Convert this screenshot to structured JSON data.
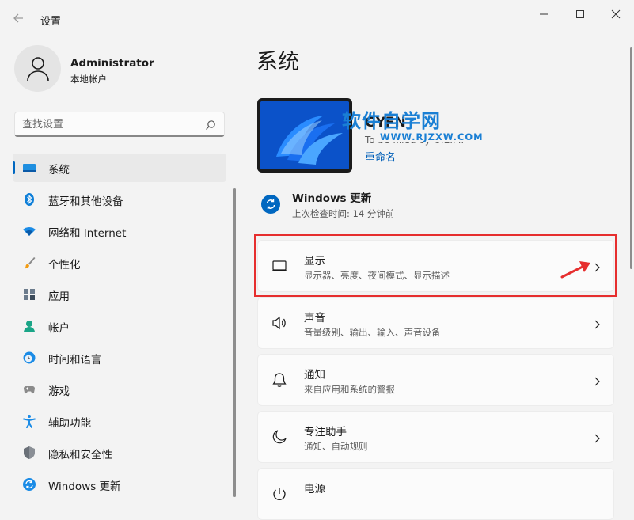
{
  "window": {
    "title": "设置"
  },
  "user": {
    "name": "Administrator",
    "account_type": "本地帐户"
  },
  "search": {
    "placeholder": "查找设置"
  },
  "nav": [
    {
      "label": "系统",
      "icon": "system-icon",
      "active": true
    },
    {
      "label": "蓝牙和其他设备",
      "icon": "bluetooth-icon"
    },
    {
      "label": "网络和 Internet",
      "icon": "network-icon"
    },
    {
      "label": "个性化",
      "icon": "brush-icon"
    },
    {
      "label": "应用",
      "icon": "apps-icon"
    },
    {
      "label": "帐户",
      "icon": "account-icon"
    },
    {
      "label": "时间和语言",
      "icon": "clock-globe-icon"
    },
    {
      "label": "游戏",
      "icon": "gamepad-icon"
    },
    {
      "label": "辅助功能",
      "icon": "accessibility-icon"
    },
    {
      "label": "隐私和安全性",
      "icon": "shield-icon"
    },
    {
      "label": "Windows 更新",
      "icon": "windows-update-icon"
    }
  ],
  "main": {
    "title": "系统",
    "device": {
      "name": "GYFN",
      "model": "To be filled by O.E.M.",
      "rename_label": "重命名"
    },
    "watermark": {
      "text": "软件自学网",
      "url": "WWW.RJZXW.COM"
    },
    "update": {
      "title": "Windows 更新",
      "subtitle": "上次检查时间: 14 分钟前"
    },
    "cards": [
      {
        "title": "显示",
        "subtitle": "显示器、亮度、夜间模式、显示描述",
        "icon": "monitor-icon"
      },
      {
        "title": "声音",
        "subtitle": "音量级别、输出、输入、声音设备",
        "icon": "speaker-icon"
      },
      {
        "title": "通知",
        "subtitle": "来自应用和系统的警报",
        "icon": "bell-icon"
      },
      {
        "title": "专注助手",
        "subtitle": "通知、自动规则",
        "icon": "moon-icon"
      },
      {
        "title": "电源",
        "subtitle": "",
        "icon": "power-icon"
      }
    ]
  },
  "colors": {
    "accent": "#0067c0",
    "highlight": "#e62e2e",
    "link": "#005fb8"
  }
}
